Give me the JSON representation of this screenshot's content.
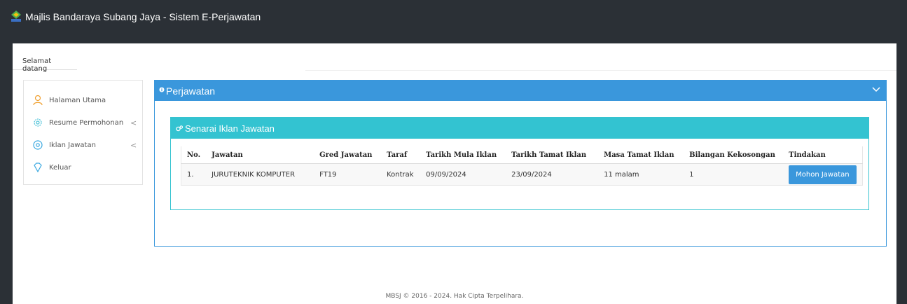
{
  "app": {
    "title": "Majlis Bandaraya Subang Jaya - Sistem E-Perjawatan",
    "welcome_tab": "Selamat datang"
  },
  "sidebar": {
    "items": [
      {
        "label": "Halaman Utama",
        "icon": "user-icon"
      },
      {
        "label": "Resume Permohonan",
        "icon": "gear-icon",
        "chevron": "<"
      },
      {
        "label": "Iklan Jawatan",
        "icon": "settings-icon",
        "chevron": "<"
      },
      {
        "label": "Keluar",
        "icon": "diamond-icon"
      }
    ]
  },
  "panel": {
    "title": "Perjawatan",
    "inner_title": "Senarai Iklan Jawatan"
  },
  "table": {
    "headers": [
      "No.",
      "Jawatan",
      "Gred Jawatan",
      "Taraf",
      "Tarikh Mula Iklan",
      "Tarikh Tamat Iklan",
      "Masa Tamat Iklan",
      "Bilangan Kekosongan",
      "Tindakan"
    ],
    "rows": [
      {
        "no": "1.",
        "jawatan": "JURUTEKNIK KOMPUTER",
        "gred": "FT19",
        "taraf": "Kontrak",
        "mula": "09/09/2024",
        "tamat": "23/09/2024",
        "masa": "11 malam",
        "bilangan": "1",
        "action": "Mohon Jawatan"
      }
    ]
  },
  "footer": {
    "text": "MBSJ © 2016 - 2024. Hak Cipta Terpelihara."
  },
  "colors": {
    "panel_blue": "#3a97dc",
    "inner_cyan": "#33c3d1",
    "topbar": "#2b3036"
  }
}
